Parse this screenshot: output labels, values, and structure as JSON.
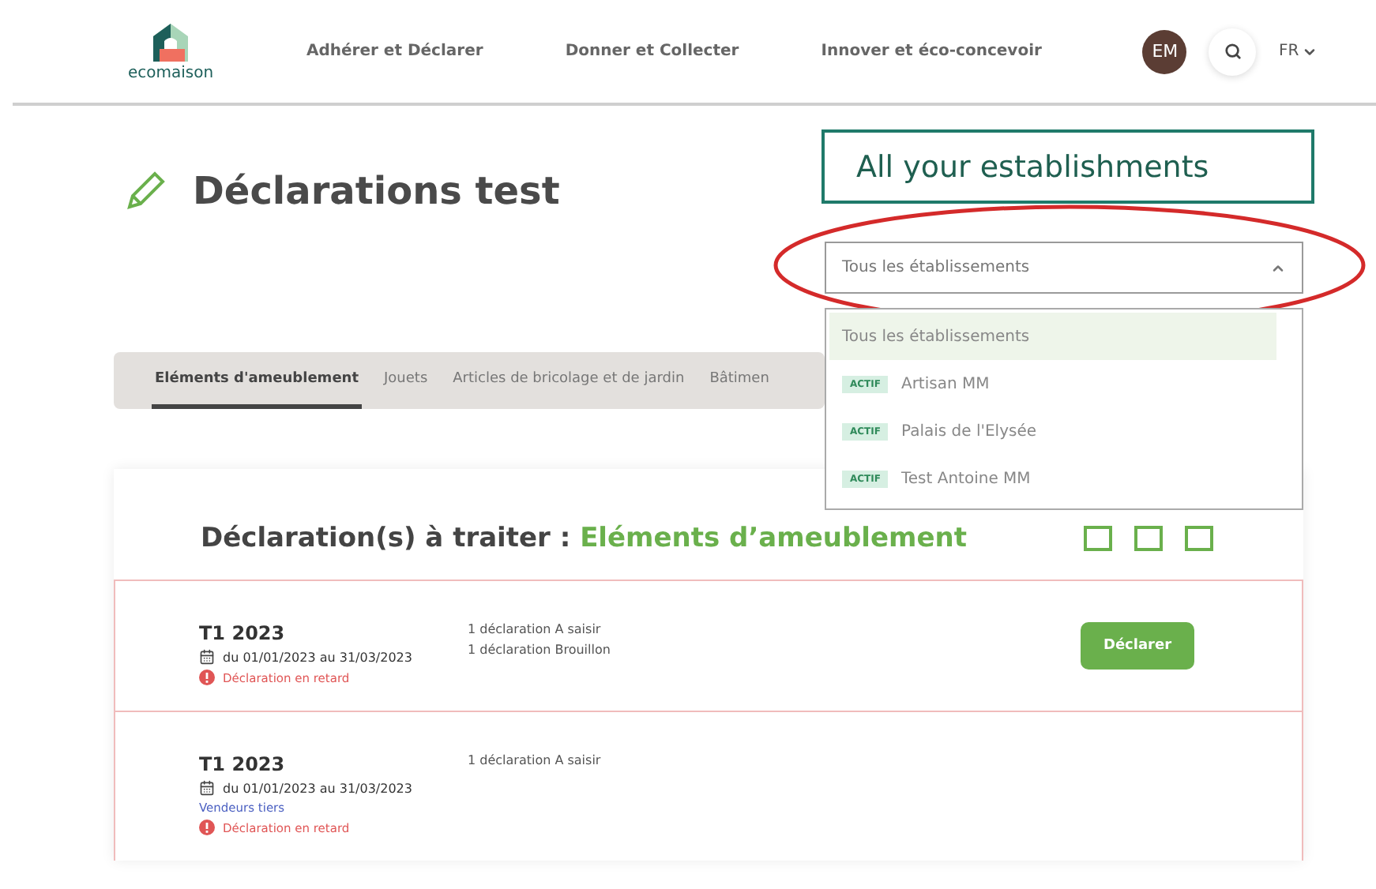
{
  "header": {
    "logo_text": "ecomaison",
    "nav": [
      "Adhérer et Déclarer",
      "Donner et Collecter",
      "Innover et éco-concevoir"
    ],
    "avatar": "EM",
    "language": "FR"
  },
  "annotation": {
    "label": "All your establishments"
  },
  "page_title": "Déclarations test",
  "establishment_select": {
    "value": "Tous les établissements",
    "expanded": true,
    "options": [
      {
        "label": "Tous les établissements",
        "selected": true
      },
      {
        "badge": "ACTIF",
        "label": "Artisan MM",
        "selected": false
      },
      {
        "badge": "ACTIF",
        "label": "Palais de l'Elysée",
        "selected": false
      },
      {
        "badge": "ACTIF",
        "label": "Test Antoine MM",
        "selected": false
      }
    ]
  },
  "tabs": [
    {
      "label": "Eléments d'ameublement",
      "selected": true
    },
    {
      "label": "Jouets",
      "selected": false
    },
    {
      "label": "Articles de bricolage et de jardin",
      "selected": false
    },
    {
      "label": "Bâtimen",
      "selected": false
    }
  ],
  "card": {
    "heading": "Déclaration(s) à traiter :",
    "category": "Eléments d’ameublement",
    "periods": [
      {
        "title": "T1 2023",
        "dates": "du 01/01/2023 au 31/03/2023",
        "alert": "Déclaration en retard",
        "statuses": [
          "1 déclaration A saisir",
          "1 déclaration Brouillon"
        ],
        "action": "Déclarer"
      },
      {
        "title": "T1 2023",
        "dates": "du 01/01/2023 au 31/03/2023",
        "seller": "Vendeurs tiers",
        "alert": "Déclaration en retard",
        "statuses": [
          "1 déclaration A saisir"
        ]
      }
    ]
  }
}
